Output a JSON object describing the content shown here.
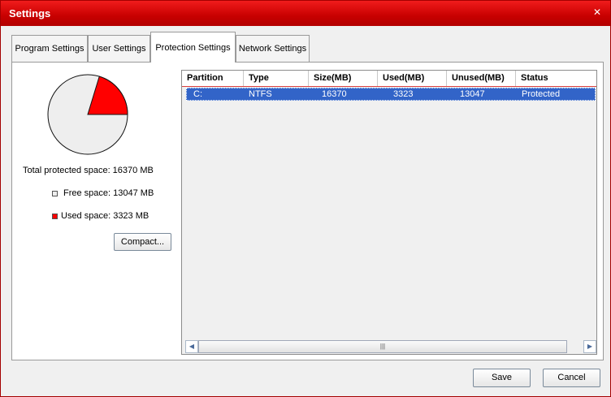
{
  "window": {
    "title": "Settings",
    "close_glyph": "✕"
  },
  "tabs": [
    {
      "label": "Program Settings"
    },
    {
      "label": "User Settings"
    },
    {
      "label": "Protection Settings",
      "active": true
    },
    {
      "label": "Network Settings"
    }
  ],
  "summary": {
    "total": "Total protected space: 16370 MB",
    "free": "Free space: 13047 MB",
    "used": "Used space: 3323 MB",
    "used_fraction": 0.203,
    "colors": {
      "free": "#eeeeee",
      "used": "#ff0000"
    }
  },
  "buttons": {
    "compact": "Compact...",
    "save": "Save",
    "cancel": "Cancel"
  },
  "table": {
    "columns": [
      "Partition",
      "Type",
      "Size(MB)",
      "Used(MB)",
      "Unused(MB)",
      "Status"
    ],
    "rows": [
      {
        "partition": "C:",
        "type": "NTFS",
        "size": "16370",
        "used": "3323",
        "unused": "13047",
        "status": "Protected"
      }
    ]
  },
  "scrollbar": {
    "left_icon": "◀",
    "right_icon": "▶",
    "thumb_grip": "|||"
  }
}
